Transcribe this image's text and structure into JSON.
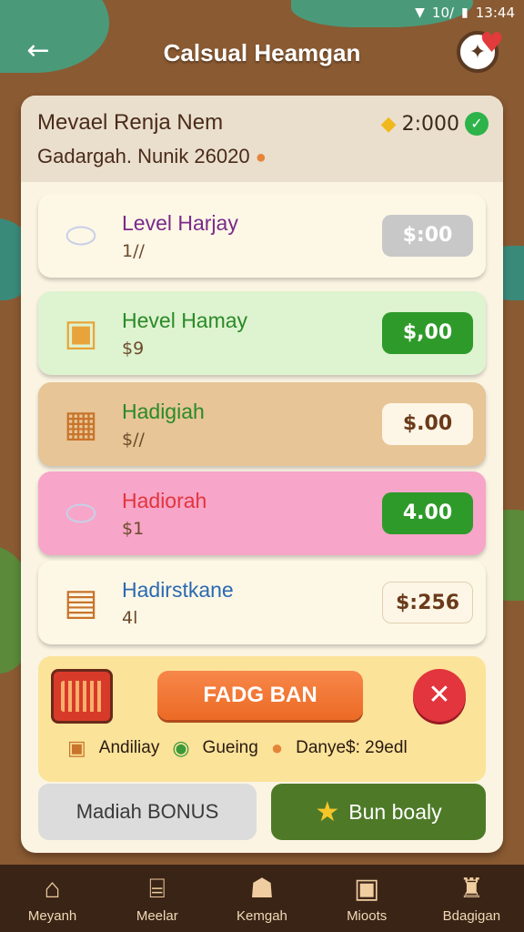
{
  "status_bar": {
    "time": "13:44",
    "network": "10/"
  },
  "header": {
    "title": "Calsual Heamgan"
  },
  "panel": {
    "title": "Mevael Renja  Nem",
    "subtitle": "Gadargah. Nunik 26020",
    "currency_value": "2:000"
  },
  "items": [
    {
      "name": "Level Harjay",
      "price": "1//",
      "button": "$:00",
      "colors": {
        "bg": "#fdf7e6",
        "name": "#7a2a8a",
        "btn_bg": "#c8c8c8",
        "btn_fg": "#ffffff"
      }
    },
    {
      "name": "Hevel Hamay",
      "price": "$9",
      "button": "$,00",
      "colors": {
        "bg": "#def3cf",
        "name": "#2a8a28",
        "btn_bg": "#2e9a2a",
        "btn_fg": "#ffffff"
      }
    },
    {
      "name": "Hadigiah",
      "price": "$//",
      "button": "$.00",
      "colors": {
        "bg": "#e7c596",
        "name": "#2a8a28",
        "btn_bg": "#fdf6e6",
        "btn_fg": "#6a3a1a"
      }
    },
    {
      "name": "Hadiorah",
      "price": "$1",
      "button": "4.00",
      "colors": {
        "bg": "#f7a5c8",
        "name": "#e2353d",
        "btn_bg": "#2e9a2a",
        "btn_fg": "#ffffff"
      }
    },
    {
      "name": "Hadirstkane",
      "price": "4l",
      "button": "$:256",
      "colors": {
        "bg": "#fdf7e6",
        "name": "#2a6ab0",
        "btn_bg": "#fdf6e6",
        "btn_fg": "#6a3a1a"
      }
    }
  ],
  "promo": {
    "button": "FADG BAN",
    "perks": [
      {
        "label": "Andiliay",
        "icon": "box-icon"
      },
      {
        "label": "Gueing",
        "icon": "coins-icon"
      },
      {
        "label": "Danye$: 29edl",
        "icon": "peach-icon"
      }
    ]
  },
  "buttons": {
    "bonus": "Madiah BONUS",
    "buy": "Bun boaly"
  },
  "nav": [
    {
      "label": "Meyanh",
      "icon": "home-icon"
    },
    {
      "label": "Meelar",
      "icon": "shop-icon"
    },
    {
      "label": "Kemgah",
      "icon": "cat-icon"
    },
    {
      "label": "Mioots",
      "icon": "quest-icon"
    },
    {
      "label": "Bdagigan",
      "icon": "castle-icon"
    }
  ]
}
